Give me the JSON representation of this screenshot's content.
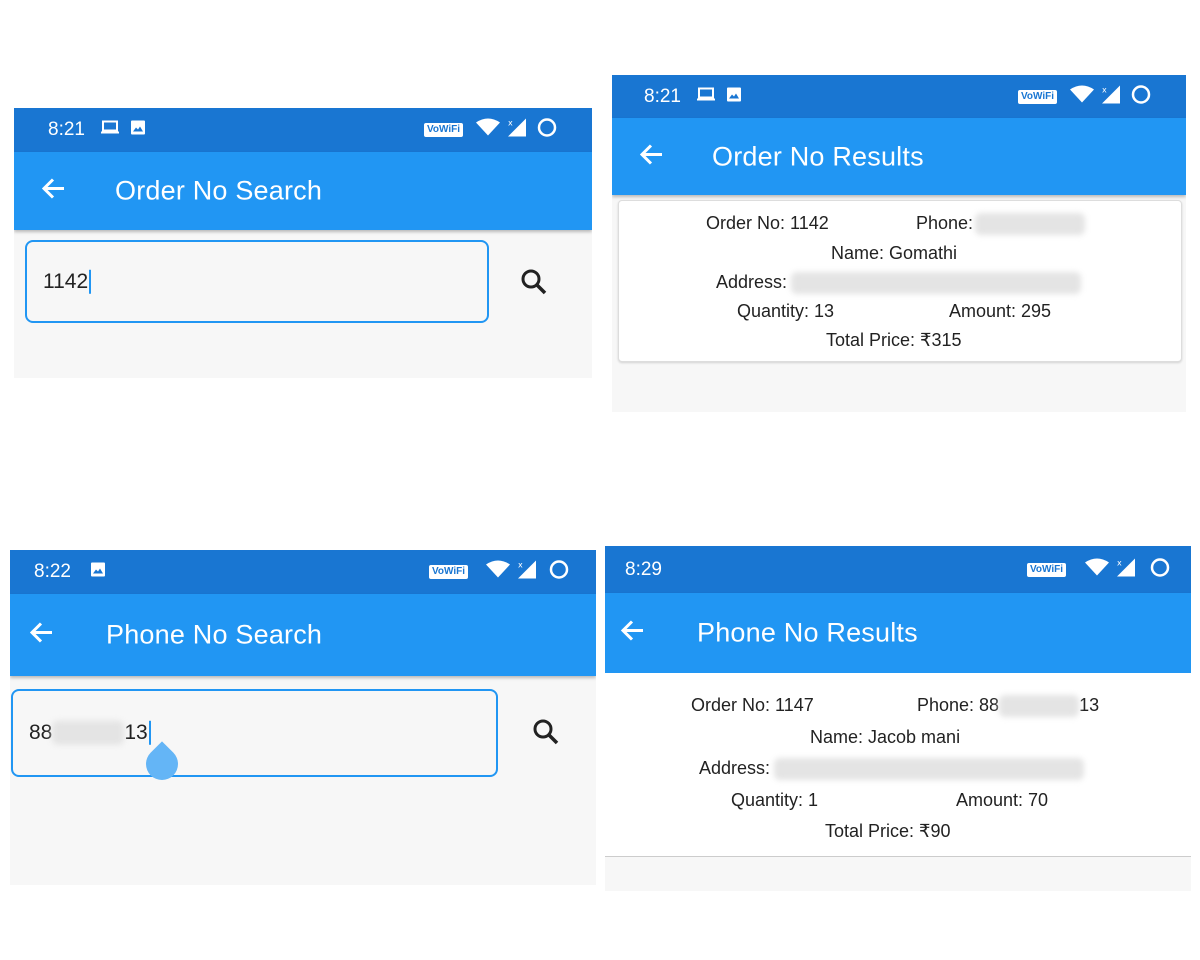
{
  "status": {
    "time_a": "8:21",
    "time_b": "8:21",
    "time_c": "8:22",
    "time_d": "8:29",
    "wifi_label": "VoWiFi",
    "icons": [
      "laptop-icon",
      "image-icon",
      "wifi-icon",
      "signal-x-icon",
      "battery-ring-icon"
    ]
  },
  "order_search": {
    "title": "Order No Search",
    "input_value": "1142"
  },
  "order_results": {
    "title": "Order No Results",
    "order_no": "Order No: 1142",
    "phone": "Phone:",
    "name": "Name: Gomathi",
    "address": "Address:",
    "quantity": "Quantity: 13",
    "amount": "Amount: 295",
    "total": "Total Price: ₹315"
  },
  "phone_search": {
    "title": "Phone No Search",
    "input_prefix": "88",
    "input_suffix": "13"
  },
  "phone_results": {
    "title": "Phone No Results",
    "order_no": "Order No: 1147",
    "phone_prefix": "Phone: 88",
    "phone_suffix": "13",
    "name": "Name: Jacob mani",
    "address": "Address:",
    "quantity": "Quantity: 1",
    "amount": "Amount: 70",
    "total": "Total Price: ₹90"
  },
  "colors": {
    "status_bar": "#1976d2",
    "app_bar": "#2196f3",
    "background": "#f7f7f7"
  }
}
